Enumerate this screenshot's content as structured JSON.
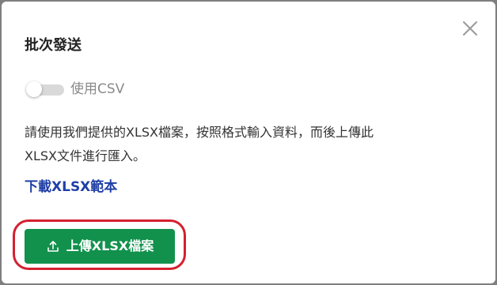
{
  "dialog": {
    "title": "批次發送",
    "close_icon": "close-icon",
    "toggle": {
      "label": "使用CSV",
      "checked": false
    },
    "description_line1": "請使用我們提供的XLSX檔案，按照格式輸入資料，而後上傳此",
    "description_line2": "XLSX文件進行匯入。",
    "download_link": "下載XLSX範本",
    "upload_button": {
      "icon": "upload-icon",
      "label": "上傳XLSX檔案"
    }
  },
  "colors": {
    "accent_green": "#11914c",
    "link_blue": "#1f3fa6",
    "highlight_red": "#d42030",
    "toggle_off": "#d9d9d9"
  }
}
